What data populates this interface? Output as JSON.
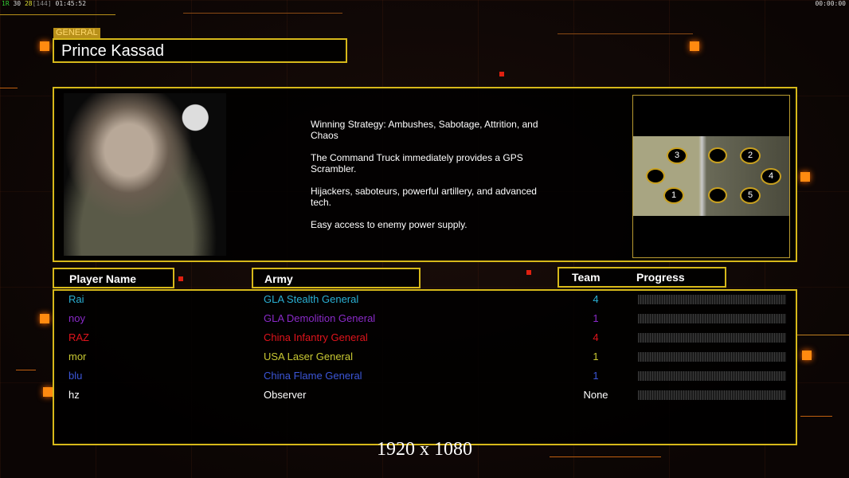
{
  "status_bar": {
    "left": {
      "a": "1R",
      "b": "30",
      "c": "28",
      "d": "[144]",
      "time": "01:45:52"
    },
    "right_time": "00:00:00"
  },
  "general": {
    "label": "GENERAL",
    "name": "Prince Kassad"
  },
  "description": [
    "Winning Strategy: Ambushes, Sabotage, Attrition, and Chaos",
    "The Command Truck immediately provides a GPS Scrambler.",
    "Hijackers, saboteurs, powerful artillery, and advanced tech.",
    "Easy access to enemy power supply."
  ],
  "map": {
    "slots": [
      "3",
      "2",
      "4",
      "1",
      "5"
    ]
  },
  "table": {
    "headers": {
      "player": "Player Name",
      "army": "Army",
      "team": "Team",
      "progress": "Progress"
    },
    "rows": [
      {
        "name": "Rai",
        "army": "GLA Stealth General",
        "team": "4",
        "color": "#2ab0d4",
        "progress": 0
      },
      {
        "name": "noy",
        "army": "GLA Demolition General",
        "team": "1",
        "color": "#8a2ac8",
        "progress": 0
      },
      {
        "name": "RAZ",
        "army": "China Infantry General",
        "team": "4",
        "color": "#e0141c",
        "progress": 0
      },
      {
        "name": "mor",
        "army": "USA Laser General",
        "team": "1",
        "color": "#c8c832",
        "progress": 0
      },
      {
        "name": "blu",
        "army": "China Flame General",
        "team": "1",
        "color": "#3c56d8",
        "progress": 0
      },
      {
        "name": "hz",
        "army": "Observer",
        "team": "None",
        "color": "#ffffff",
        "progress": 0
      }
    ]
  },
  "resolution": "1920 x 1080"
}
